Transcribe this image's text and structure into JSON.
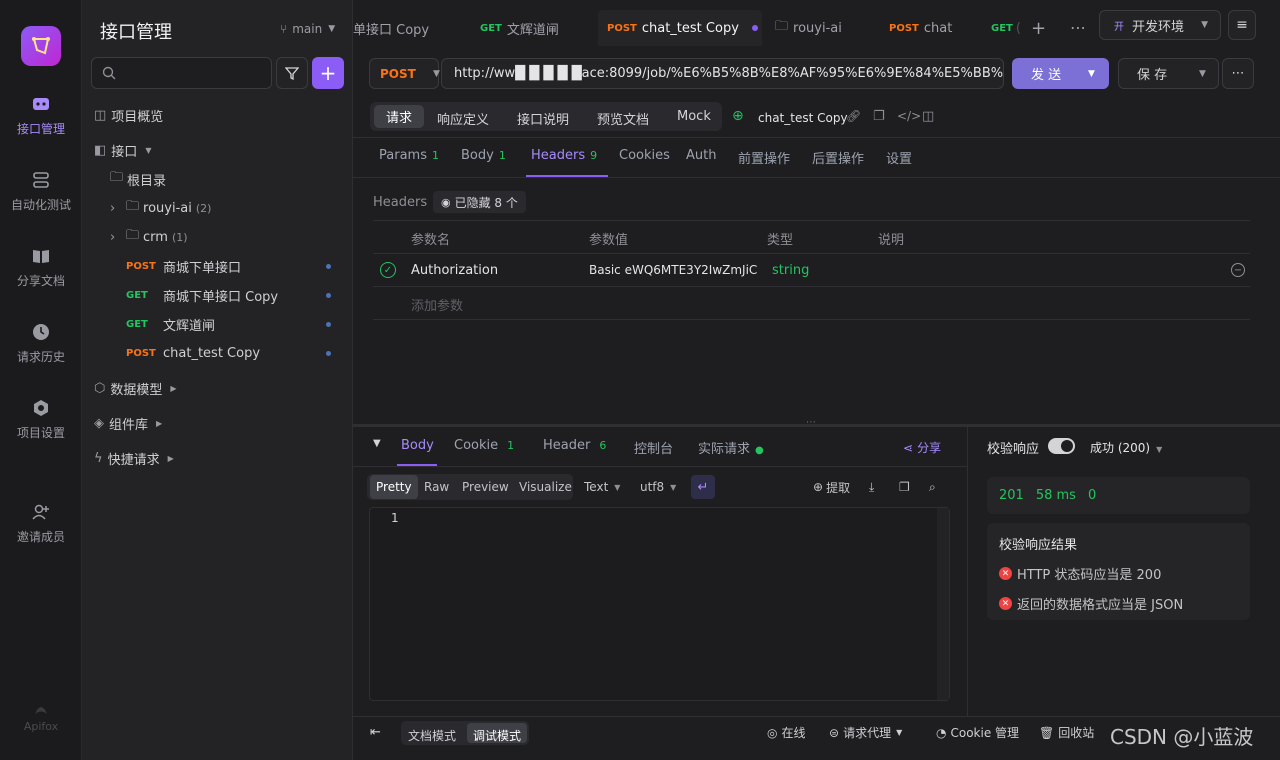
{
  "rail": {
    "items": [
      {
        "label": "接口管理",
        "icon": "api-manage-icon"
      },
      {
        "label": "自动化测试",
        "icon": "automation-icon"
      },
      {
        "label": "分享文档",
        "icon": "book-icon"
      },
      {
        "label": "请求历史",
        "icon": "history-icon"
      },
      {
        "label": "项目设置",
        "icon": "settings-icon"
      },
      {
        "label": "邀请成员",
        "icon": "invite-icon"
      }
    ],
    "brand": "Apifox"
  },
  "sidebar": {
    "title": "接口管理",
    "branch": "main",
    "search_placeholder": "",
    "nav": [
      {
        "label": "项目概览"
      },
      {
        "label": "接口"
      }
    ],
    "root": "根目录",
    "folders": [
      {
        "name": "rouyi-ai",
        "count": "(2)"
      },
      {
        "name": "crm",
        "count": "(1)"
      }
    ],
    "apis": [
      {
        "method": "POST",
        "name": "商城下单接口"
      },
      {
        "method": "GET",
        "name": "商城下单接口 Copy"
      },
      {
        "method": "GET",
        "name": "文辉道闸"
      },
      {
        "method": "POST",
        "name": "chat_test Copy"
      }
    ],
    "sections": [
      {
        "label": "数据模型"
      },
      {
        "label": "组件库"
      },
      {
        "label": "快捷请求"
      }
    ]
  },
  "tabs": [
    {
      "method": "",
      "name": "单接口 Copy"
    },
    {
      "method": "GET",
      "name": "文辉道闸"
    },
    {
      "method": "POST",
      "name": "chat_test Copy"
    },
    {
      "method": "",
      "name": "rouyi-ai"
    },
    {
      "method": "POST",
      "name": "chat"
    },
    {
      "method": "GET",
      "name": "("
    }
  ],
  "env": {
    "badge": "开",
    "label": "开发环境"
  },
  "request": {
    "method": "POST",
    "url": "http://ww█ █ █ █ █ace:8099/job/%E6%B5%8B%E8%AF%95%E6%9E%84%E5%BB%BI",
    "send": "发 送",
    "save": "保 存"
  },
  "modes": [
    "请求",
    "响应定义",
    "接口说明",
    "预览文档",
    "Mock"
  ],
  "api_name": "chat_test Copy",
  "param_tabs": [
    {
      "label": "Params",
      "count": "1"
    },
    {
      "label": "Body",
      "count": "1"
    },
    {
      "label": "Headers",
      "count": "9"
    },
    {
      "label": "Cookies",
      "count": ""
    },
    {
      "label": "Auth",
      "count": ""
    },
    {
      "label": "前置操作",
      "count": ""
    },
    {
      "label": "后置操作",
      "count": ""
    },
    {
      "label": "设置",
      "count": ""
    }
  ],
  "headers": {
    "label": "Headers",
    "hidden": "已隐藏 8 个",
    "columns": [
      "参数名",
      "参数值",
      "类型",
      "说明"
    ],
    "rows": [
      {
        "name": "Authorization",
        "value": "Basic eWQ6MTE3Y2IwZmJiC",
        "type": "string",
        "desc": ""
      }
    ],
    "add": "添加参数"
  },
  "response": {
    "tabs": [
      {
        "label": "Body",
        "count": ""
      },
      {
        "label": "Cookie",
        "count": "1"
      },
      {
        "label": "Header",
        "count": "6"
      },
      {
        "label": "控制台",
        "count": ""
      },
      {
        "label": "实际请求",
        "count": ""
      }
    ],
    "share": "分享",
    "formats": [
      "Pretty",
      "Raw",
      "Preview",
      "Visualize"
    ],
    "text": "Text",
    "encoding": "utf8",
    "extract": "提取",
    "line1": "1"
  },
  "validate": {
    "label": "校验响应",
    "status": "成功 (200)",
    "code": "201",
    "time": "58 ms",
    "size": "0",
    "result_title": "校验响应结果",
    "results": [
      "HTTP 状态码应当是 200",
      "返回的数据格式应当是 JSON"
    ]
  },
  "footer": {
    "doc_mode": "文档模式",
    "debug_mode": "调试模式",
    "online": "在线",
    "proxy": "请求代理",
    "cookie": "Cookie 管理",
    "trash": "回收站",
    "watermark": "CSDN @小蓝波"
  },
  "colors": {
    "accent": "#8b5cf6",
    "post": "#f97316",
    "get": "#22c55e",
    "error": "#ef4444"
  }
}
